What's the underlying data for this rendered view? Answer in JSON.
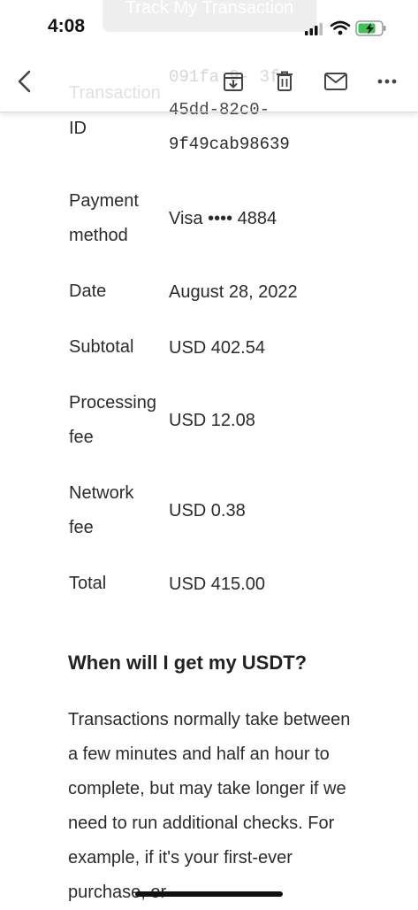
{
  "status_bar": {
    "time": "4:08",
    "behind_text": "Track My Transaction"
  },
  "toolbar": {
    "icons": [
      "back-icon",
      "archive-icon",
      "trash-icon",
      "mail-icon",
      "more-icon"
    ]
  },
  "transaction": {
    "id_label_line1": "Transaction",
    "id_label_line2": "ID",
    "id_line1": "091fa 9-  3f",
    "id_line2": "45dd-82c0-",
    "id_line3": "9f49cab98639",
    "payment_label_line1": "Payment",
    "payment_label_line2": "method",
    "payment_value": "Visa •••• 4884",
    "date_label": "Date",
    "date_value": "August 28, 2022",
    "subtotal_label": "Subtotal",
    "subtotal_value": "USD 402.54",
    "processing_label_line1": "Processing",
    "processing_label_line2": "fee",
    "processing_value": "USD 12.08",
    "network_label_line1": "Network",
    "network_label_line2": "fee",
    "network_value": "USD 0.38",
    "total_label": "Total",
    "total_value": "USD 415.00"
  },
  "faq": {
    "heading": "When will I get my USDT?",
    "paragraph": "Transactions normally take between a few minutes and half an hour to complete, but may take longer if we need to run additional checks. For example, if it's your first-ever purchase, or"
  },
  "colors": {
    "text": "#2b2b2b",
    "toolbar_icon": "#444444",
    "battery_green": "#3ec356"
  }
}
